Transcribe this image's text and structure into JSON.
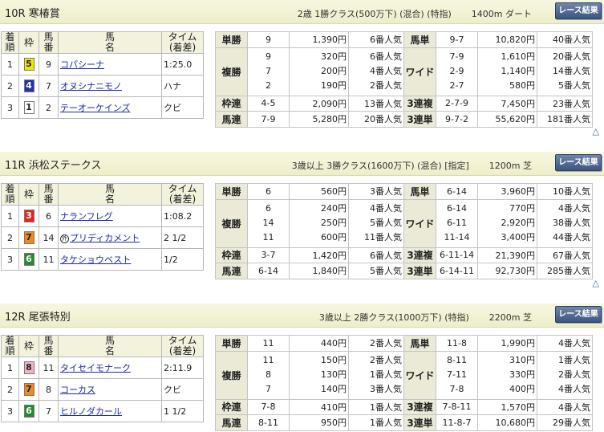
{
  "races": [
    {
      "title": "10R 寒椿賞",
      "conditions": "2歳 1勝クラス(500万下) (混合) (特指)",
      "distance": "1400m ダート",
      "button_label": "レース結果",
      "headers": {
        "rank": "着順",
        "frame": "枠",
        "horse_no": "馬番",
        "name": "馬名",
        "time": "タイム(着差)"
      },
      "results": [
        {
          "rank": "1",
          "frame": "5",
          "frame_bg": "#f5e600",
          "frame_fg": "#222222",
          "num": "9",
          "mark": "",
          "name": "コパシーナ",
          "time": "1:25.0"
        },
        {
          "rank": "2",
          "frame": "4",
          "frame_bg": "#2233aa",
          "frame_fg": "#ffffff",
          "num": "7",
          "mark": "",
          "name": "オヌシナニモノ",
          "time": "ハナ"
        },
        {
          "rank": "3",
          "frame": "1",
          "frame_bg": "#ffffff",
          "frame_fg": "#222222",
          "num": "2",
          "mark": "",
          "name": "テーオーケインズ",
          "time": "クビ"
        }
      ],
      "payouts": {
        "tansho": {
          "label": "単勝",
          "nums": [
            "9"
          ],
          "amts": [
            "1,390円"
          ],
          "pops": [
            "6番人気"
          ]
        },
        "fukusho": {
          "label": "複勝",
          "nums": [
            "9",
            "7",
            "2"
          ],
          "amts": [
            "320円",
            "200円",
            "190円"
          ],
          "pops": [
            "6番人気",
            "4番人気",
            "2番人気"
          ]
        },
        "wakuren": {
          "label": "枠連",
          "nums": [
            "4-5"
          ],
          "amts": [
            "2,090円"
          ],
          "pops": [
            "13番人気"
          ]
        },
        "umaren": {
          "label": "馬連",
          "nums": [
            "7-9"
          ],
          "amts": [
            "5,280円"
          ],
          "pops": [
            "20番人気"
          ]
        },
        "umatan": {
          "label": "馬単",
          "nums": [
            "9-7"
          ],
          "amts": [
            "10,820円"
          ],
          "pops": [
            "40番人気"
          ]
        },
        "wide": {
          "label": "ワイド",
          "nums": [
            "7-9",
            "2-9",
            "2-7"
          ],
          "amts": [
            "1,610円",
            "1,140円",
            "580円"
          ],
          "pops": [
            "20番人気",
            "14番人気",
            "5番人気"
          ]
        },
        "sanrenpuku": {
          "label": "3連複",
          "nums": [
            "2-7-9"
          ],
          "amts": [
            "7,450円"
          ],
          "pops": [
            "23番人気"
          ]
        },
        "sanrentan": {
          "label": "3連単",
          "nums": [
            "9-7-2"
          ],
          "amts": [
            "55,620円"
          ],
          "pops": [
            "181番人気"
          ]
        }
      }
    },
    {
      "title": "11R 浜松ステークス",
      "conditions": "3歳以上 3勝クラス(1600万下) (混合) [指定]",
      "distance": "1200m 芝",
      "button_label": "レース結果",
      "headers": {
        "rank": "着順",
        "frame": "枠",
        "horse_no": "馬番",
        "name": "馬名",
        "time": "タイム(着差)"
      },
      "results": [
        {
          "rank": "1",
          "frame": "3",
          "frame_bg": "#e8231f",
          "frame_fg": "#ffffff",
          "num": "6",
          "mark": "",
          "name": "ナランフレグ",
          "time": "1:08.2"
        },
        {
          "rank": "2",
          "frame": "7",
          "frame_bg": "#f08a1c",
          "frame_fg": "#222222",
          "num": "14",
          "mark": "外",
          "name": "プリディカメント",
          "time": "2 1/2"
        },
        {
          "rank": "3",
          "frame": "6",
          "frame_bg": "#1f8a2e",
          "frame_fg": "#ffffff",
          "num": "11",
          "mark": "",
          "name": "タケショウベスト",
          "time": "1/2"
        }
      ],
      "payouts": {
        "tansho": {
          "label": "単勝",
          "nums": [
            "6"
          ],
          "amts": [
            "560円"
          ],
          "pops": [
            "3番人気"
          ]
        },
        "fukusho": {
          "label": "複勝",
          "nums": [
            "6",
            "14",
            "11"
          ],
          "amts": [
            "240円",
            "250円",
            "600円"
          ],
          "pops": [
            "4番人気",
            "5番人気",
            "11番人気"
          ]
        },
        "wakuren": {
          "label": "枠連",
          "nums": [
            "3-7"
          ],
          "amts": [
            "1,420円"
          ],
          "pops": [
            "6番人気"
          ]
        },
        "umaren": {
          "label": "馬連",
          "nums": [
            "6-14"
          ],
          "amts": [
            "1,840円"
          ],
          "pops": [
            "5番人気"
          ]
        },
        "umatan": {
          "label": "馬単",
          "nums": [
            "6-14"
          ],
          "amts": [
            "3,960円"
          ],
          "pops": [
            "10番人気"
          ]
        },
        "wide": {
          "label": "ワイド",
          "nums": [
            "6-14",
            "6-11",
            "11-14"
          ],
          "amts": [
            "770円",
            "2,920円",
            "3,400円"
          ],
          "pops": [
            "4番人気",
            "38番人気",
            "44番人気"
          ]
        },
        "sanrenpuku": {
          "label": "3連複",
          "nums": [
            "6-11-14"
          ],
          "amts": [
            "21,390円"
          ],
          "pops": [
            "67番人気"
          ]
        },
        "sanrentan": {
          "label": "3連単",
          "nums": [
            "6-14-11"
          ],
          "amts": [
            "92,730円"
          ],
          "pops": [
            "285番人気"
          ]
        }
      }
    },
    {
      "title": "12R 尾張特別",
      "conditions": "3歳以上 2勝クラス(1000万下) (特指)",
      "distance": "2200m 芝",
      "button_label": "レース結果",
      "headers": {
        "rank": "着順",
        "frame": "枠",
        "horse_no": "馬番",
        "name": "馬名",
        "time": "タイム(着差)"
      },
      "results": [
        {
          "rank": "1",
          "frame": "8",
          "frame_bg": "#f7b3c4",
          "frame_fg": "#222222",
          "num": "11",
          "mark": "",
          "name": "タイセイモナーク",
          "time": "2:11.9"
        },
        {
          "rank": "2",
          "frame": "7",
          "frame_bg": "#f08a1c",
          "frame_fg": "#222222",
          "num": "8",
          "mark": "",
          "name": "コーカス",
          "time": "クビ"
        },
        {
          "rank": "3",
          "frame": "6",
          "frame_bg": "#1f8a2e",
          "frame_fg": "#ffffff",
          "num": "7",
          "mark": "",
          "name": "ヒルノダカール",
          "time": "1 1/2"
        }
      ],
      "payouts": {
        "tansho": {
          "label": "単勝",
          "nums": [
            "11"
          ],
          "amts": [
            "440円"
          ],
          "pops": [
            "2番人気"
          ]
        },
        "fukusho": {
          "label": "複勝",
          "nums": [
            "11",
            "8",
            "7"
          ],
          "amts": [
            "150円",
            "130円",
            "140円"
          ],
          "pops": [
            "2番人気",
            "1番人気",
            "3番人気"
          ]
        },
        "wakuren": {
          "label": "枠連",
          "nums": [
            "7-8"
          ],
          "amts": [
            "410円"
          ],
          "pops": [
            "1番人気"
          ]
        },
        "umaren": {
          "label": "馬連",
          "nums": [
            "8-11"
          ],
          "amts": [
            "950円"
          ],
          "pops": [
            "1番人気"
          ]
        },
        "umatan": {
          "label": "馬単",
          "nums": [
            "11-8"
          ],
          "amts": [
            "1,990円"
          ],
          "pops": [
            "4番人気"
          ]
        },
        "wide": {
          "label": "ワイド",
          "nums": [
            "8-11",
            "7-11",
            "7-8"
          ],
          "amts": [
            "310円",
            "330円",
            "400円"
          ],
          "pops": [
            "1番人気",
            "2番人気",
            "4番人気"
          ]
        },
        "sanrenpuku": {
          "label": "3連複",
          "nums": [
            "7-8-11"
          ],
          "amts": [
            "1,570円"
          ],
          "pops": [
            "4番人気"
          ]
        },
        "sanrentan": {
          "label": "3連単",
          "nums": [
            "11-8-7"
          ],
          "amts": [
            "10,680円"
          ],
          "pops": [
            "29番人気"
          ]
        }
      }
    }
  ],
  "scroll_top_symbol": "△"
}
